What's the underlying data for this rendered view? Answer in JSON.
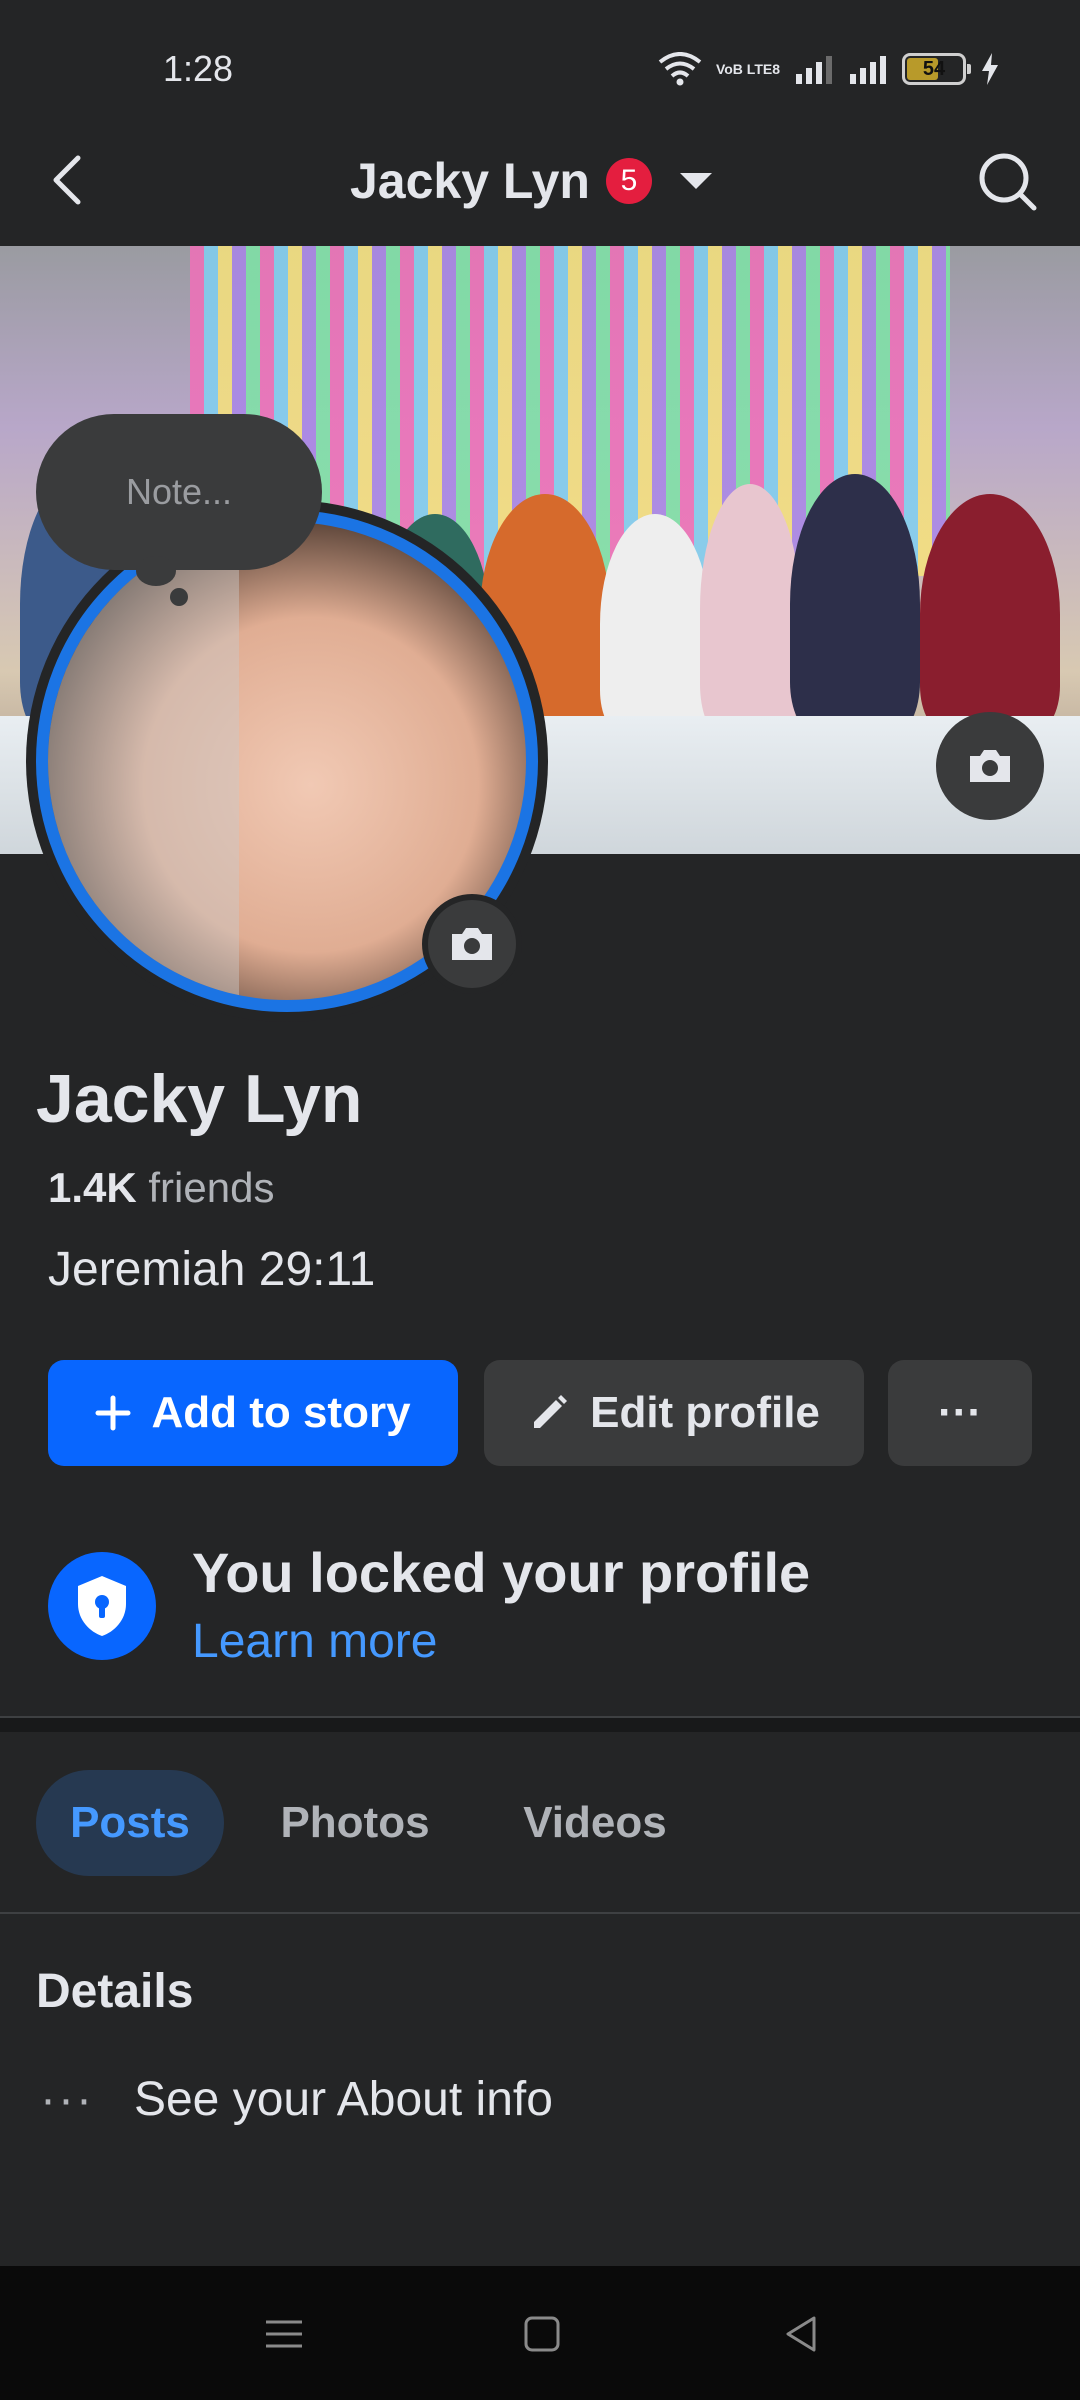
{
  "status_bar": {
    "time": "1:28",
    "network": "VoB LTE8",
    "battery": "54"
  },
  "header": {
    "title": "Jacky Lyn",
    "notification_count": "5"
  },
  "profile": {
    "note_placeholder": "Note...",
    "name": "Jacky Lyn",
    "friends_count": "1.4K",
    "friends_label": "friends",
    "bio": "Jeremiah 29:11"
  },
  "actions": {
    "add_story": "Add to story",
    "edit_profile": "Edit profile",
    "more": "···"
  },
  "locked": {
    "title": "You locked your profile",
    "link": "Learn more"
  },
  "tabs": [
    {
      "label": "Posts",
      "active": true
    },
    {
      "label": "Photos",
      "active": false
    },
    {
      "label": "Videos",
      "active": false
    }
  ],
  "details": {
    "title": "Details",
    "about_dots": "···",
    "about_text": "See your About info"
  },
  "colors": {
    "accent": "#0866ff",
    "link": "#4599ff",
    "badge": "#e41e3f",
    "background": "#242526"
  },
  "icons": [
    "back-arrow-icon",
    "search-icon",
    "camera-icon",
    "plus-icon",
    "pencil-icon",
    "shield-lock-icon",
    "menu-icon",
    "home-square-icon",
    "back-triangle-icon"
  ]
}
